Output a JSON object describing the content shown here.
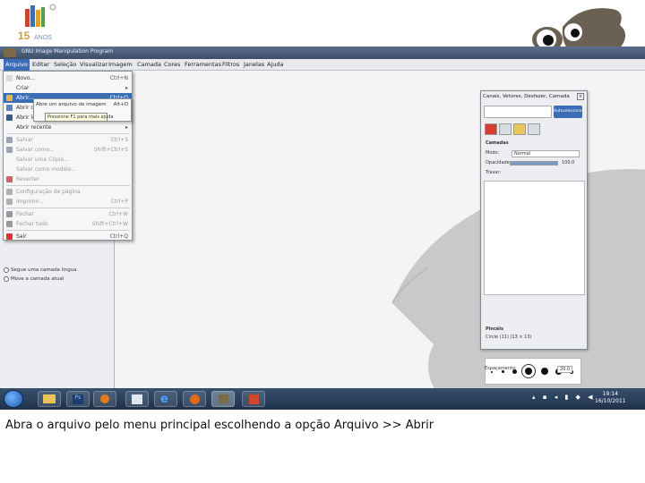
{
  "window": {
    "title": "GNU Image Manipulation Program"
  },
  "menubar": [
    "Arquivo",
    "Editar",
    "Seleção",
    "Visualizar",
    "Imagem",
    "Camada",
    "Cores",
    "Ferramentas",
    "Filtros",
    "Janelas",
    "Ajuda"
  ],
  "file_menu": [
    {
      "label": "Novo...",
      "shortcut": "Ctrl+N",
      "state": "normal",
      "icon": "new-icon"
    },
    {
      "label": "Criar",
      "shortcut": "▸",
      "state": "normal",
      "icon": ""
    },
    {
      "label": "Abrir...",
      "shortcut": "Ctrl+O",
      "state": "highlight",
      "icon": "open-icon"
    },
    {
      "label": "Abrir como camadas...",
      "shortcut": "Ctrl+Alt+O",
      "state": "normal",
      "icon": "open-layers-icon"
    },
    {
      "label": "Abrir local...",
      "shortcut": "",
      "state": "normal",
      "icon": "location-icon"
    },
    {
      "label": "Abrir recente",
      "shortcut": "▸",
      "state": "normal",
      "icon": ""
    },
    {
      "label": "Salvar",
      "shortcut": "Ctrl+S",
      "state": "disabled",
      "icon": "save-icon"
    },
    {
      "label": "Salvar como...",
      "shortcut": "Shift+Ctrl+S",
      "state": "disabled",
      "icon": "save-as-icon"
    },
    {
      "label": "Salvar uma Cópia...",
      "shortcut": "",
      "state": "disabled",
      "icon": ""
    },
    {
      "label": "Salvar como modelo...",
      "shortcut": "",
      "state": "disabled",
      "icon": ""
    },
    {
      "label": "Reverter",
      "shortcut": "",
      "state": "disabled",
      "icon": "revert-icon"
    },
    {
      "label": "Configuração de página",
      "shortcut": "",
      "state": "disabled",
      "icon": "page-setup-icon"
    },
    {
      "label": "Imprimir...",
      "shortcut": "Ctrl+P",
      "state": "disabled",
      "icon": "print-icon"
    },
    {
      "label": "Fechar",
      "shortcut": "Ctrl+W",
      "state": "disabled",
      "icon": "close-icon"
    },
    {
      "label": "Fechar tudo",
      "shortcut": "Shift+Ctrl+W",
      "state": "disabled",
      "icon": "close-all-icon"
    },
    {
      "label": "Sair",
      "shortcut": "Ctrl+Q",
      "state": "normal",
      "icon": "quit-icon"
    }
  ],
  "submenu": {
    "line1": "Abre um arquivo de imagem",
    "line1_shortcut": "Alt+O",
    "line2": "Pressione F1 para mais ajuda"
  },
  "toolbox_options": {
    "opt1": "Segue uma camada lingua",
    "opt2": "Move a camada atual"
  },
  "dock": {
    "title": "Canais, Vetores, Desfazer, Camada",
    "auto_button": "Autoselecionar",
    "layers_label": "Camadas",
    "mode_label": "Modo:",
    "mode_value": "Normal",
    "opacity_label": "Opacidade:",
    "opacity_value": "100.0",
    "lock_label": "Travar:",
    "brush_label": "Pincéis",
    "brush_name": "Circle (11) (13 × 13)",
    "spacing_label": "Espaçamento:",
    "spacing_value": "20.0",
    "opacity_fraction": 1.0
  },
  "taskbar": {
    "time": "19:14",
    "date": "16/10/2011"
  },
  "caption": "Abra o arquivo pelo menu principal escolhendo a opção Arquivo >> Abrir",
  "colors": {
    "accent": "#3b6db7",
    "taskbar": "#1f3149"
  }
}
